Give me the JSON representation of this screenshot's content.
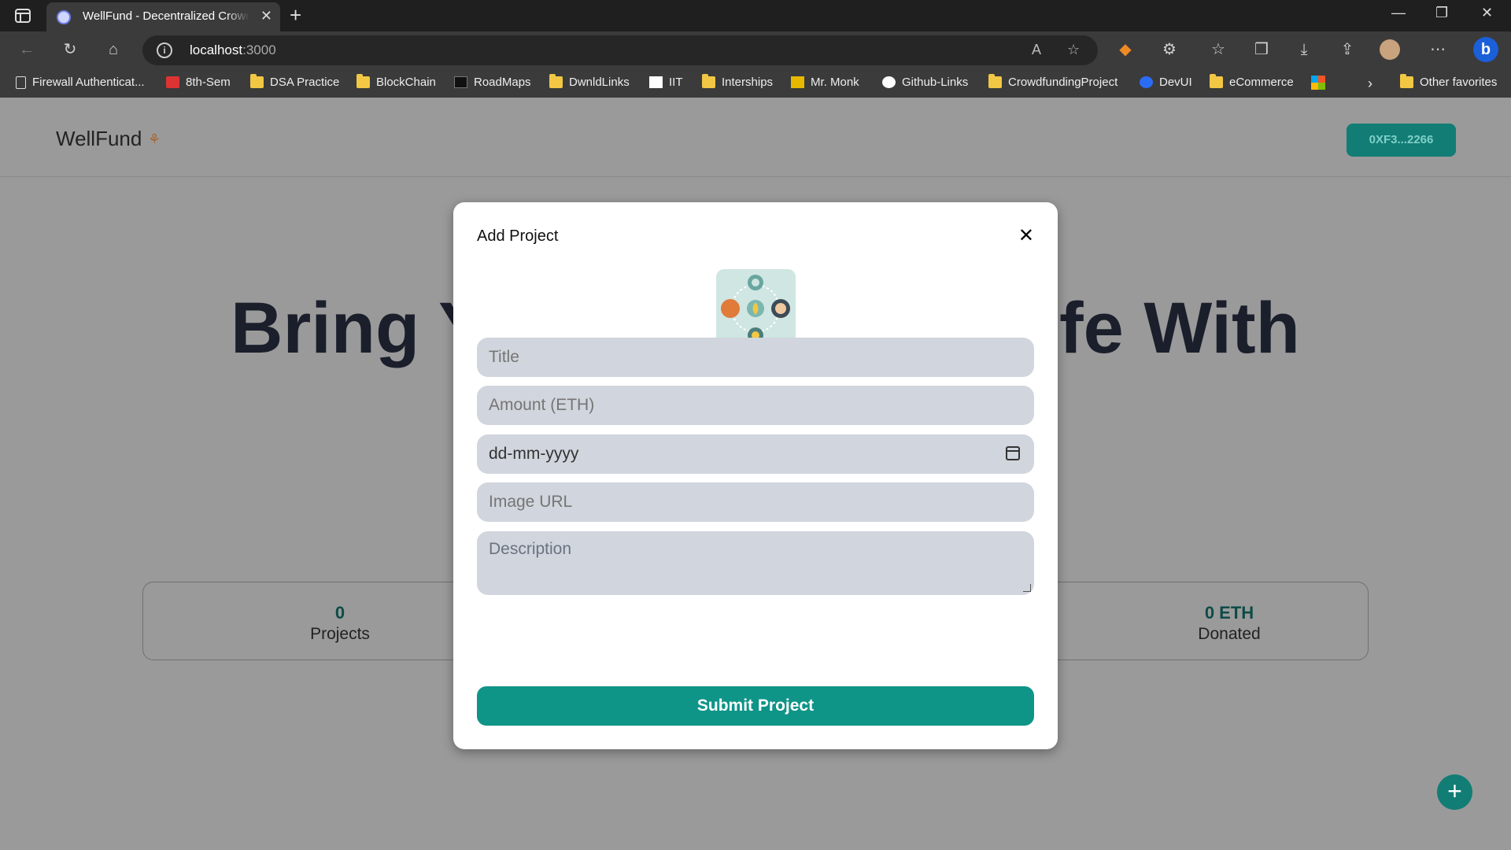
{
  "browser": {
    "tab_title": "WellFund - Decentralized Crowdfunding",
    "tab_close": "✕",
    "new_tab": "+",
    "url_host": "localhost",
    "url_port": ":3000",
    "window": {
      "minimize": "—",
      "restore": "❐",
      "close": "✕"
    }
  },
  "bookmarks": [
    {
      "label": "Firewall Authenticat...",
      "icon": "page-icon"
    },
    {
      "label": "8th-Sem",
      "icon": "pdf-icon"
    },
    {
      "label": "DSA Practice",
      "icon": "folder-icon"
    },
    {
      "label": "BlockChain",
      "icon": "folder-icon"
    },
    {
      "label": "RoadMaps",
      "icon": "roadmap-icon"
    },
    {
      "label": "DwnldLinks",
      "icon": "folder-icon"
    },
    {
      "label": "IIT",
      "icon": "iit-icon"
    },
    {
      "label": "Interships",
      "icon": "folder-icon"
    },
    {
      "label": "Mr. Monk",
      "icon": "monk-icon"
    },
    {
      "label": "Github-Links",
      "icon": "github-icon"
    },
    {
      "label": "CrowdfundingProject",
      "icon": "folder-icon"
    },
    {
      "label": "DevUI",
      "icon": "devui-icon"
    },
    {
      "label": "eCommerce",
      "icon": "folder-icon"
    },
    {
      "label": "",
      "icon": "microsoft-icon"
    },
    {
      "label": "Other favorites",
      "icon": "folder-icon"
    }
  ],
  "app": {
    "brand": "WellFund",
    "wallet_address": "0XF3...2266",
    "hero_left": "Bring Y",
    "hero_right": "fe With",
    "stats": {
      "projects_value": "0",
      "projects_label": "Projects",
      "donated_value": "0 ETH",
      "donated_label": "Donated"
    },
    "fab": "+"
  },
  "modal": {
    "title": "Add Project",
    "close": "✕",
    "fields": {
      "title_placeholder": "Title",
      "amount_placeholder": "Amount (ETH)",
      "date_placeholder": "dd-mm-yyyy",
      "image_placeholder": "Image URL",
      "description_placeholder": "Description"
    },
    "submit_label": "Submit Project"
  },
  "colors": {
    "accent": "#0f9488",
    "overlay": "#9a9a9a",
    "input_bg": "#d1d5dd"
  }
}
